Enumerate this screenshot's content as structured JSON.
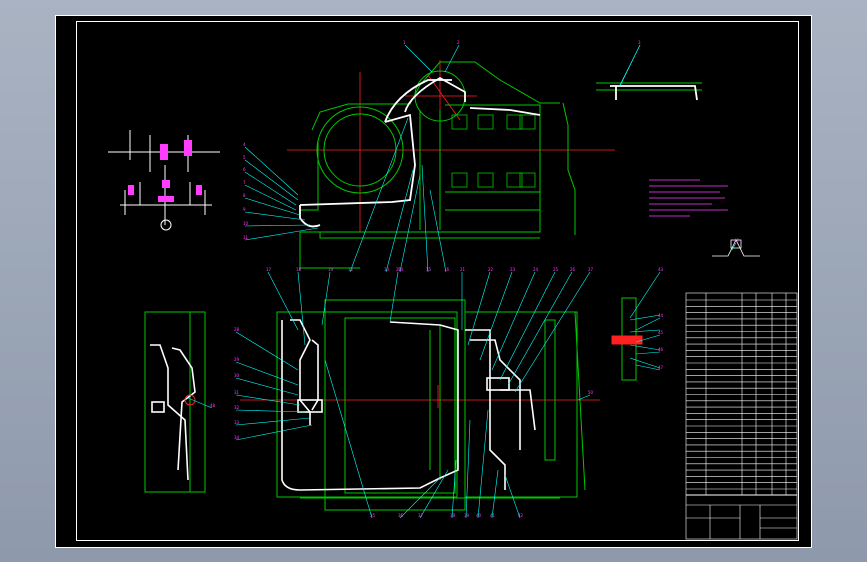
{
  "drawing": {
    "balloon_labels": [
      "1",
      "2",
      "3",
      "4",
      "5",
      "6",
      "7",
      "8",
      "9",
      "10",
      "11",
      "12",
      "13",
      "14",
      "15",
      "16",
      "17",
      "18",
      "19",
      "20",
      "21",
      "22",
      "23",
      "24",
      "25",
      "26",
      "27",
      "28",
      "29",
      "30",
      "31",
      "32",
      "33",
      "34",
      "35",
      "36",
      "37",
      "38",
      "39",
      "40",
      "41",
      "42",
      "43",
      "44",
      "45",
      "46",
      "47",
      "48",
      "49",
      "50"
    ],
    "schematic_caption": "",
    "notes_heading": "",
    "notes_lines": [
      "",
      "",
      "",
      "",
      "",
      "",
      ""
    ],
    "section_label": "",
    "title_block": {
      "drawing_title": "",
      "drawing_number": "",
      "scale": ""
    },
    "colors": {
      "background": "#000000",
      "frame": "#ffffff",
      "outline": "#00c800",
      "centerline": "#ff0000",
      "leader": "#00ffff",
      "annotation": "#ff3cff",
      "pipe": "#ffffff"
    }
  }
}
